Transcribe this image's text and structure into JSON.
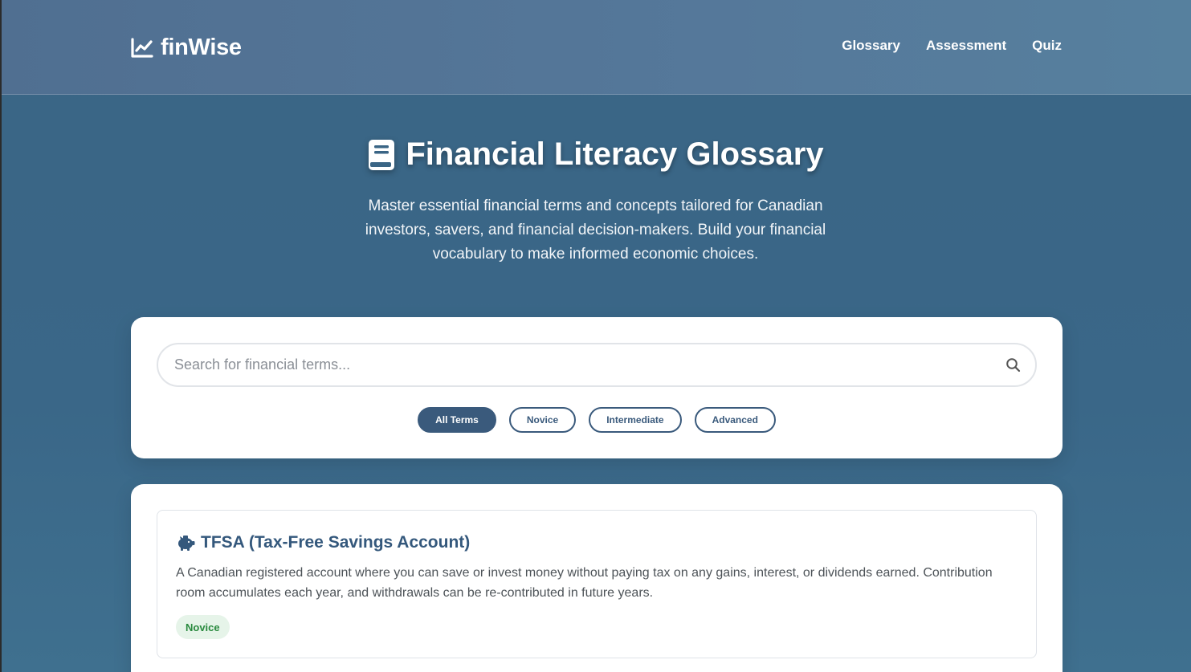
{
  "header": {
    "brand": "finWise",
    "nav": [
      "Glossary",
      "Assessment",
      "Quiz"
    ]
  },
  "hero": {
    "title": "Financial Literacy Glossary",
    "subtitle": "Master essential financial terms and concepts tailored for Canadian investors, savers, and financial decision-makers. Build your financial vocabulary to make informed economic choices."
  },
  "search": {
    "placeholder": "Search for financial terms...",
    "value": ""
  },
  "filters": {
    "items": [
      "All Terms",
      "Novice",
      "Intermediate",
      "Advanced"
    ],
    "active": "All Terms"
  },
  "terms": [
    {
      "icon": "piggy-bank-icon",
      "title": "TFSA (Tax-Free Savings Account)",
      "description": "A Canadian registered account where you can save or invest money without paying tax on any gains, interest, or dividends earned. Contribution room accumulates each year, and withdrawals can be re-contributed in future years.",
      "level": "Novice"
    }
  ],
  "colors": {
    "primary": "#3a5a7c",
    "background": "#3a6788",
    "novice_badge_bg": "#e6f4e9",
    "novice_badge_text": "#2a8a3f"
  }
}
